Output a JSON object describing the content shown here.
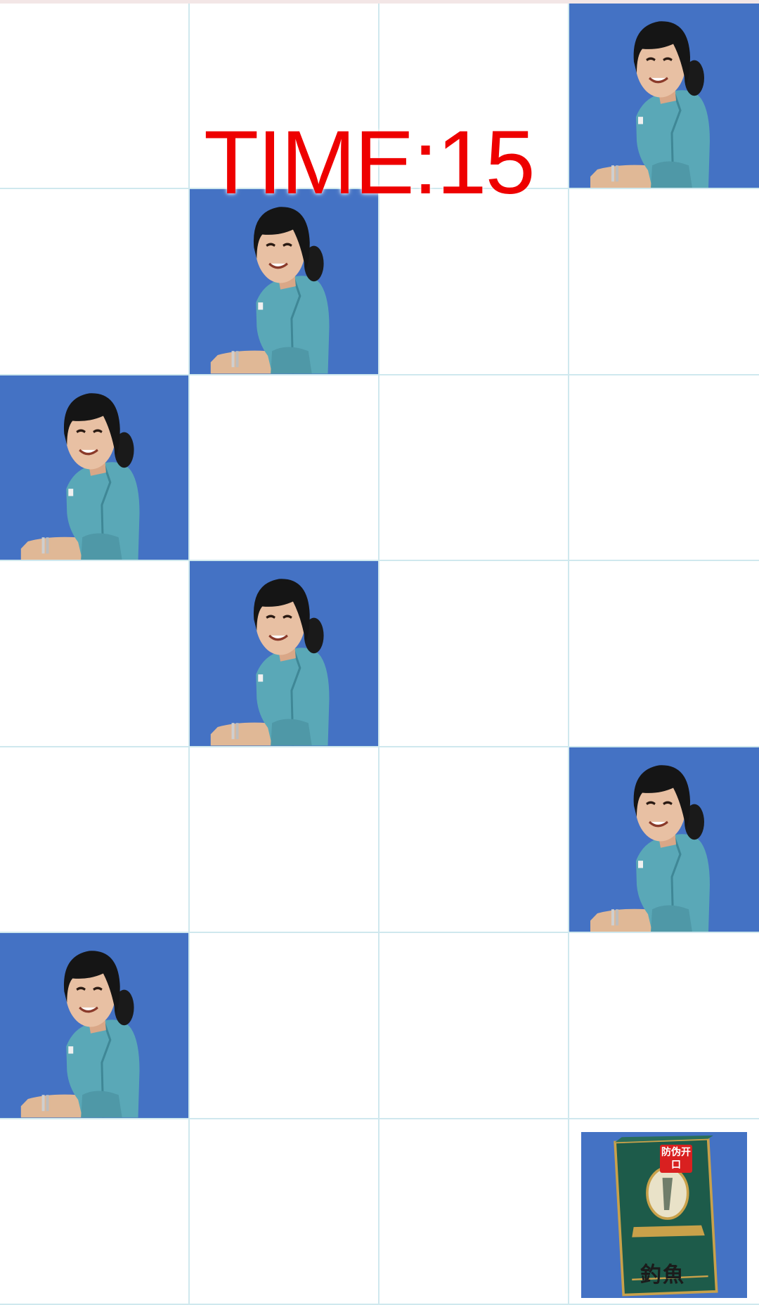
{
  "hud": {
    "timer_label": "TIME:",
    "timer_value": "15"
  },
  "board": {
    "columns": 4,
    "rows": 7,
    "tiles": [
      [
        "empty",
        "empty",
        "empty",
        "person"
      ],
      [
        "empty",
        "person",
        "empty",
        "empty"
      ],
      [
        "person",
        "empty",
        "empty",
        "empty"
      ],
      [
        "empty",
        "person",
        "empty",
        "empty"
      ],
      [
        "empty",
        "empty",
        "empty",
        "person"
      ],
      [
        "person",
        "empty",
        "empty",
        "empty"
      ],
      [
        "empty",
        "empty",
        "empty",
        "item"
      ]
    ]
  },
  "item": {
    "name": "釣魚",
    "badge": "防伪开口"
  },
  "colors": {
    "active_tile": "#4472c4",
    "grid_line": "#cfe8ee",
    "timer": "#ee0000"
  },
  "icons": {
    "person": "smiling-woman-photo",
    "item": "cigarette-pack-photo"
  }
}
